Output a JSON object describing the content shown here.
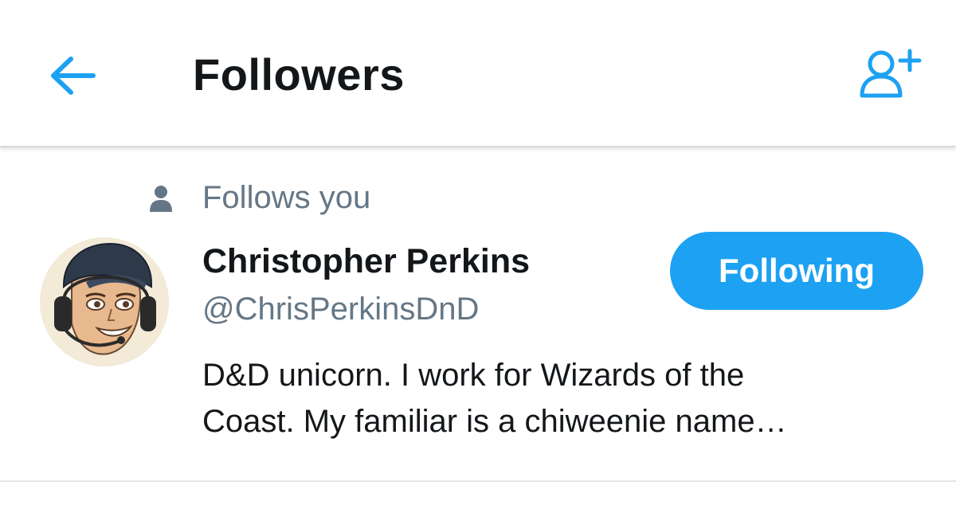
{
  "header": {
    "title": "Followers",
    "back_icon": "arrow-left-icon",
    "add_user_icon": "add-user-icon",
    "accent_color": "#1da1f2"
  },
  "followers": [
    {
      "follows_you_label": "Follows you",
      "name": "Christopher Perkins",
      "handle": "@ChrisPerkinsDnD",
      "bio_lines": [
        "D&D unicorn. I work for Wizards of the",
        "Coast. My familiar is a chiweenie name…"
      ],
      "follow_button_label": "Following",
      "avatar_icon": "cartoon-avatar-with-headset"
    }
  ]
}
